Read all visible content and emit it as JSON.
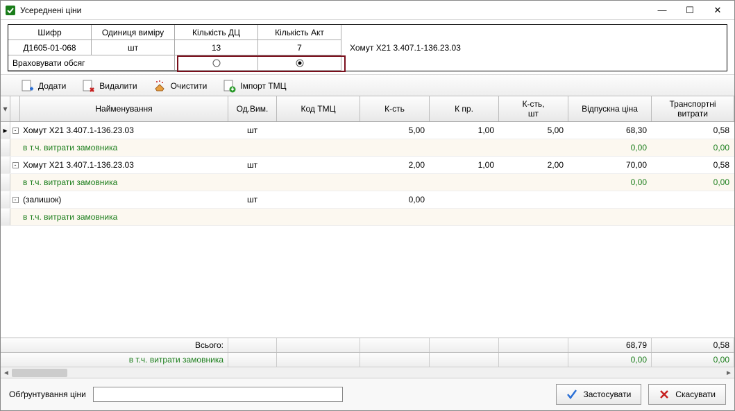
{
  "window": {
    "title": "Усереднені ціни"
  },
  "info": {
    "headers": {
      "shifr": "Шифр",
      "unit": "Одиниця виміру",
      "qty_dc": "Кількість ДЦ",
      "qty_akt": "Кількість Акт"
    },
    "row": {
      "shifr": "Д1605-01-068",
      "unit": "шт",
      "qty_dc": "13",
      "qty_akt": "7"
    },
    "side_label": "Хомут Х21 3.407.1-136.23.03",
    "consider_label": "Враховувати обсяг",
    "radio_dc_selected": false,
    "radio_akt_selected": true
  },
  "toolbar": {
    "add": "Додати",
    "delete": "Видалити",
    "clear": "Очистити",
    "import": "Імпорт ТМЦ"
  },
  "grid": {
    "headers": {
      "name": "Найменування",
      "unit": "Од.Вим.",
      "code": "Код ТМЦ",
      "qty": "К-сть",
      "kpr": "К пр.",
      "qty_sht": "К-сть,\nшт",
      "price": "Відпускна ціна",
      "transport": "Транспортні\nвитрати"
    },
    "rows": [
      {
        "type": "parent",
        "name": "Хомут Х21 3.407.1-136.23.03",
        "unit": "шт",
        "code": "",
        "qty": "5,00",
        "kpr": "1,00",
        "qty_sht": "5,00",
        "price": "68,30",
        "transport": "0,58",
        "marker": true
      },
      {
        "type": "child",
        "name": "в т.ч. витрати замовника",
        "unit": "",
        "code": "",
        "qty": "",
        "kpr": "",
        "qty_sht": "",
        "price": "0,00",
        "transport": "0,00"
      },
      {
        "type": "parent",
        "name": "Хомут Х21 3.407.1-136.23.03",
        "unit": "шт",
        "code": "",
        "qty": "2,00",
        "kpr": "1,00",
        "qty_sht": "2,00",
        "price": "70,00",
        "transport": "0,58"
      },
      {
        "type": "child",
        "name": "в т.ч. витрати замовника",
        "unit": "",
        "code": "",
        "qty": "",
        "kpr": "",
        "qty_sht": "",
        "price": "0,00",
        "transport": "0,00"
      },
      {
        "type": "parent",
        "name": "(залишок)",
        "unit": "шт",
        "code": "",
        "qty": "0,00",
        "kpr": "",
        "qty_sht": "",
        "price": "",
        "transport": ""
      },
      {
        "type": "child",
        "name": "в т.ч. витрати замовника",
        "unit": "",
        "code": "",
        "qty": "",
        "kpr": "",
        "qty_sht": "",
        "price": "",
        "transport": ""
      }
    ],
    "totals": {
      "label": "Всього:",
      "child_label": "в т.ч. витрати замовника",
      "price": "68,79",
      "transport": "0,58",
      "child_price": "0,00",
      "child_transport": "0,00"
    }
  },
  "footer": {
    "justify_label": "Обґрунтування ціни",
    "justify_value": "",
    "apply": "Застосувати",
    "cancel": "Скасувати"
  }
}
